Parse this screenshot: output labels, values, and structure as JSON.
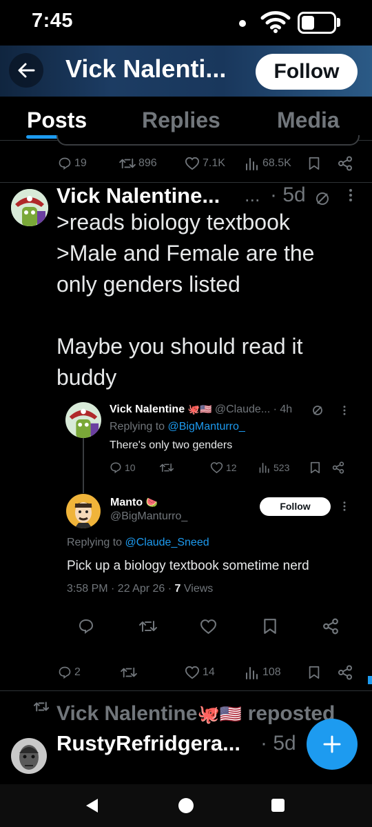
{
  "status_bar": {
    "time": "7:45"
  },
  "header": {
    "title": "Vick Nalenti...",
    "follow_label": "Follow"
  },
  "tabs": [
    {
      "label": "Posts",
      "active": true
    },
    {
      "label": "Replies",
      "active": false
    },
    {
      "label": "Media",
      "active": false
    }
  ],
  "prev_post": {
    "replies": "19",
    "reposts": "896",
    "likes": "7.1K",
    "views": "68.5K"
  },
  "post": {
    "name": "Vick Nalentine...",
    "handle_ellipsis": "...",
    "time": "· 5d",
    "text": ">reads biology textbook\n>Male and Female are the only genders listed\n\nMaybe you should read it buddy",
    "quoted": {
      "name": "Vick Nalentine",
      "handle": "@Claude...",
      "time": "· 4h",
      "replying_prefix": "Replying to",
      "replying_handle": "@BigManturro_",
      "text": "There's only two genders",
      "replies": "10",
      "likes": "12",
      "views": "523"
    },
    "reply": {
      "name": "Manto",
      "handle": "@BigManturro_",
      "follow_label": "Follow",
      "replying_prefix": "Replying to",
      "replying_handle": "@Claude_Sneed",
      "text": "Pick up a biology textbook sometime nerd",
      "timestamp": "3:58 PM · 22 Apr 26 ·",
      "views_count": "7",
      "views_label": "Views"
    },
    "replies": "2",
    "likes": "14",
    "views": "108"
  },
  "repost": {
    "label": "Vick Nalentine",
    "label_suffix": "reposted",
    "name": "RustyRefridgera...",
    "time": "· 5d"
  },
  "colors": {
    "accent": "#1d9bf0",
    "muted": "#71767b",
    "background": "#000000"
  },
  "icons": [
    "back-arrow-icon",
    "wifi-icon",
    "battery-icon",
    "reply-icon",
    "repost-icon",
    "like-icon",
    "views-icon",
    "bookmark-icon",
    "share-icon",
    "grok-icon",
    "more-icon",
    "plus-icon"
  ]
}
